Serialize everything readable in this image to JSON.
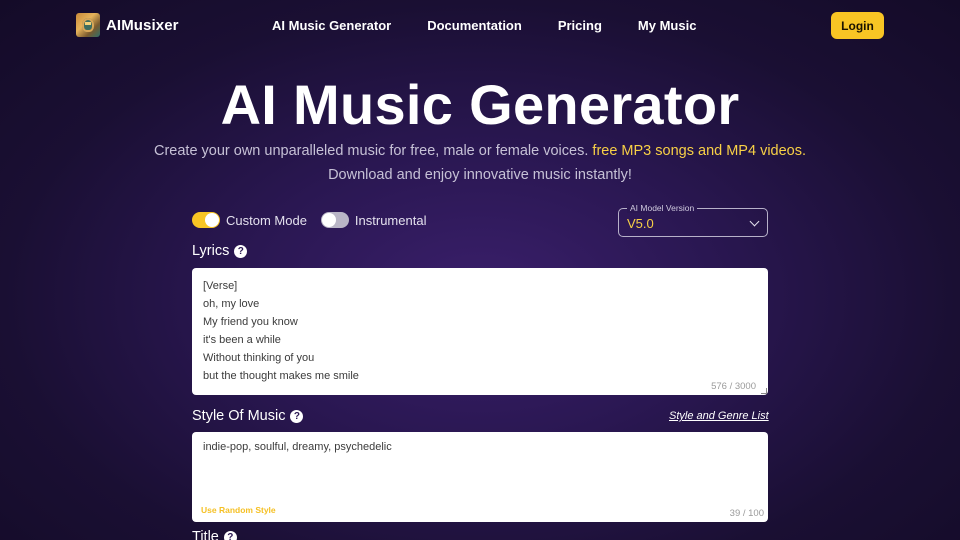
{
  "nav": {
    "brand": "AIMusixer",
    "links": [
      "AI Music Generator",
      "Documentation",
      "Pricing",
      "My Music"
    ],
    "login": "Login"
  },
  "hero": {
    "title": "AI Music Generator",
    "subtitle_line1_pre": "Create your own unparalleled music for free, male or female voices.",
    "subtitle_line1_highlight": "free MP3 songs and MP4 videos.",
    "subtitle_line2": "Download and enjoy innovative music instantly!"
  },
  "form": {
    "custom_mode_label": "Custom Mode",
    "custom_mode_on": true,
    "instrumental_label": "Instrumental",
    "instrumental_on": false,
    "model_legend": "AI Model Version",
    "model_value": "V5.0",
    "lyrics_label": "Lyrics",
    "lyrics_lines": [
      "[Verse]",
      "oh, my love",
      "My friend you know",
      "it's been a while",
      "Without thinking of you",
      "but the thought makes me smile"
    ],
    "lyrics_counter": "576 / 3000",
    "style_label": "Style Of Music",
    "style_link": "Style and Genre List",
    "style_value": "indie-pop, soulful, dreamy, psychedelic",
    "random_style": "Use Random Style",
    "style_counter": "39 / 100",
    "title_label": "Title"
  },
  "colors": {
    "accent": "#f8c524",
    "highlight": "#f8d046",
    "background": "#2a1752"
  }
}
